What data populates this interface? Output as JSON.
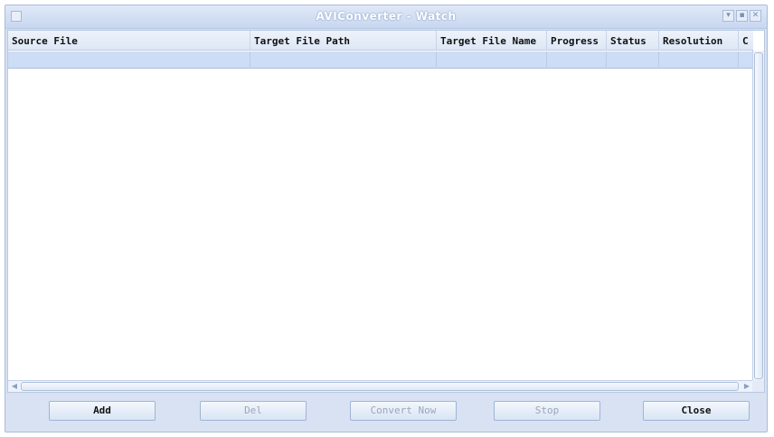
{
  "window": {
    "title": "AVIConverter - Watch",
    "controls": [
      "▾",
      "▪",
      "✕"
    ]
  },
  "table": {
    "columns": [
      "Source File",
      "Target File Path",
      "Target File Name",
      "Progress",
      "Status",
      "Resolution",
      "C"
    ],
    "rows": []
  },
  "buttons": {
    "add": "Add",
    "del": "Del",
    "convert": "Convert Now",
    "stop": "Stop",
    "close": "Close"
  }
}
